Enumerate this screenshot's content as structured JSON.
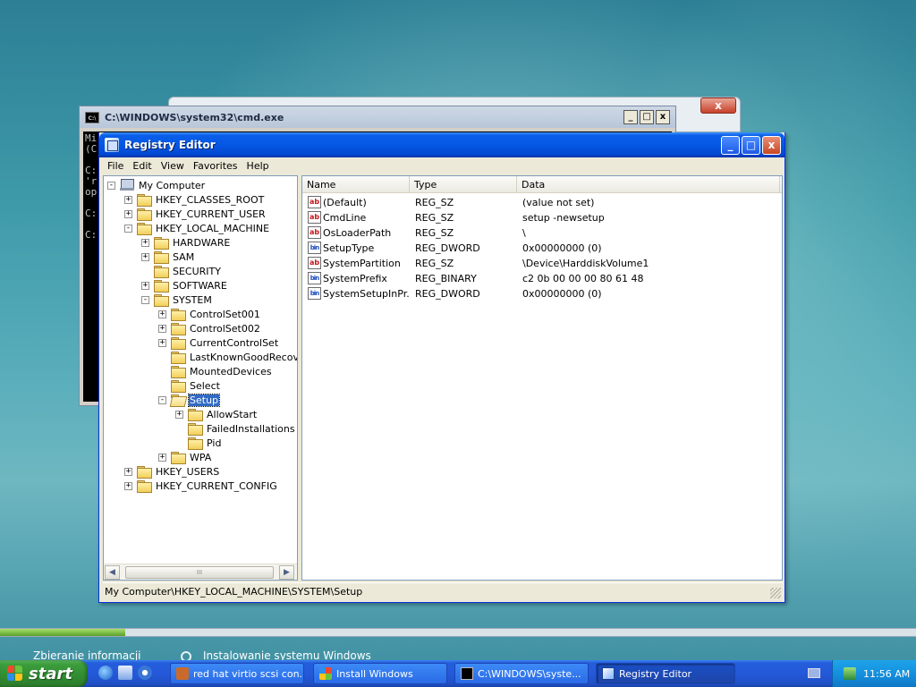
{
  "colors": {
    "xp_title_blue": "#0558e5",
    "selection": "#316ac5",
    "taskbar": "#245edb",
    "start_green": "#318c31"
  },
  "setup_window": {
    "close_label": "x"
  },
  "cmd_window": {
    "title": "C:\\WINDOWS\\system32\\cmd.exe",
    "icon_label": "C:\\",
    "buttons": [
      "_",
      "□",
      "x"
    ],
    "body_text": "Mi\n(C\n\nC:\n'r\nop\n\nC:\n\nC:"
  },
  "regedit": {
    "title": "Registry Editor",
    "window_buttons": [
      "_",
      "□",
      "x"
    ],
    "menu": [
      "File",
      "Edit",
      "View",
      "Favorites",
      "Help"
    ],
    "tree": [
      {
        "label": "My Computer",
        "level": 0,
        "expander": "-",
        "icon": "computer"
      },
      {
        "label": "HKEY_CLASSES_ROOT",
        "level": 1,
        "expander": "+",
        "icon": "folder"
      },
      {
        "label": "HKEY_CURRENT_USER",
        "level": 1,
        "expander": "+",
        "icon": "folder"
      },
      {
        "label": "HKEY_LOCAL_MACHINE",
        "level": 1,
        "expander": "-",
        "icon": "folder"
      },
      {
        "label": "HARDWARE",
        "level": 2,
        "expander": "+",
        "icon": "folder"
      },
      {
        "label": "SAM",
        "level": 2,
        "expander": "+",
        "icon": "folder"
      },
      {
        "label": "SECURITY",
        "level": 2,
        "expander": "",
        "icon": "folder"
      },
      {
        "label": "SOFTWARE",
        "level": 2,
        "expander": "+",
        "icon": "folder"
      },
      {
        "label": "SYSTEM",
        "level": 2,
        "expander": "-",
        "icon": "folder"
      },
      {
        "label": "ControlSet001",
        "level": 3,
        "expander": "+",
        "icon": "folder"
      },
      {
        "label": "ControlSet002",
        "level": 3,
        "expander": "+",
        "icon": "folder"
      },
      {
        "label": "CurrentControlSet",
        "level": 3,
        "expander": "+",
        "icon": "folder"
      },
      {
        "label": "LastKnownGoodRecovery",
        "level": 3,
        "expander": "",
        "icon": "folder"
      },
      {
        "label": "MountedDevices",
        "level": 3,
        "expander": "",
        "icon": "folder"
      },
      {
        "label": "Select",
        "level": 3,
        "expander": "",
        "icon": "folder"
      },
      {
        "label": "Setup",
        "level": 3,
        "expander": "-",
        "icon": "folder-open",
        "selected": true
      },
      {
        "label": "AllowStart",
        "level": 4,
        "expander": "+",
        "icon": "folder"
      },
      {
        "label": "FailedInstallations",
        "level": 4,
        "expander": "",
        "icon": "folder"
      },
      {
        "label": "Pid",
        "level": 4,
        "expander": "",
        "icon": "folder"
      },
      {
        "label": "WPA",
        "level": 3,
        "expander": "+",
        "icon": "folder"
      },
      {
        "label": "HKEY_USERS",
        "level": 1,
        "expander": "+",
        "icon": "folder"
      },
      {
        "label": "HKEY_CURRENT_CONFIG",
        "level": 1,
        "expander": "+",
        "icon": "folder"
      }
    ],
    "scrollbar": {
      "left_arrow": "◀",
      "right_arrow": "▶",
      "grip": "III"
    },
    "columns": [
      "Name",
      "Type",
      "Data"
    ],
    "values": [
      {
        "name": "(Default)",
        "type": "REG_SZ",
        "data": "(value not set)",
        "icon": "ab"
      },
      {
        "name": "CmdLine",
        "type": "REG_SZ",
        "data": "setup -newsetup",
        "icon": "ab"
      },
      {
        "name": "OsLoaderPath",
        "type": "REG_SZ",
        "data": "\\",
        "icon": "ab"
      },
      {
        "name": "SetupType",
        "type": "REG_DWORD",
        "data": "0x00000000 (0)",
        "icon": "bin"
      },
      {
        "name": "SystemPartition",
        "type": "REG_SZ",
        "data": "\\Device\\HarddiskVolume1",
        "icon": "ab"
      },
      {
        "name": "SystemPrefix",
        "type": "REG_BINARY",
        "data": "c2 0b 00 00 00 80 61 48",
        "icon": "bin"
      },
      {
        "name": "SystemSetupInPr...",
        "type": "REG_DWORD",
        "data": "0x00000000 (0)",
        "icon": "bin"
      }
    ],
    "status_path": "My Computer\\HKEY_LOCAL_MACHINE\\SYSTEM\\Setup"
  },
  "setup_progress": {
    "fraction": 0.137,
    "steps": [
      "Zbieranie informacji",
      "Instalowanie systemu Windows"
    ]
  },
  "taskbar": {
    "start_label": "start",
    "tasks": [
      {
        "label": "red hat virtio scsi con...",
        "icon": "browser-icon"
      },
      {
        "label": "Install Windows",
        "icon": "windows-flag-icon"
      },
      {
        "label": "C:\\WINDOWS\\syste...",
        "icon": "cmd-icon"
      },
      {
        "label": "Registry Editor",
        "icon": "regedit-icon",
        "active": true
      }
    ],
    "clock": "11:56 AM"
  }
}
